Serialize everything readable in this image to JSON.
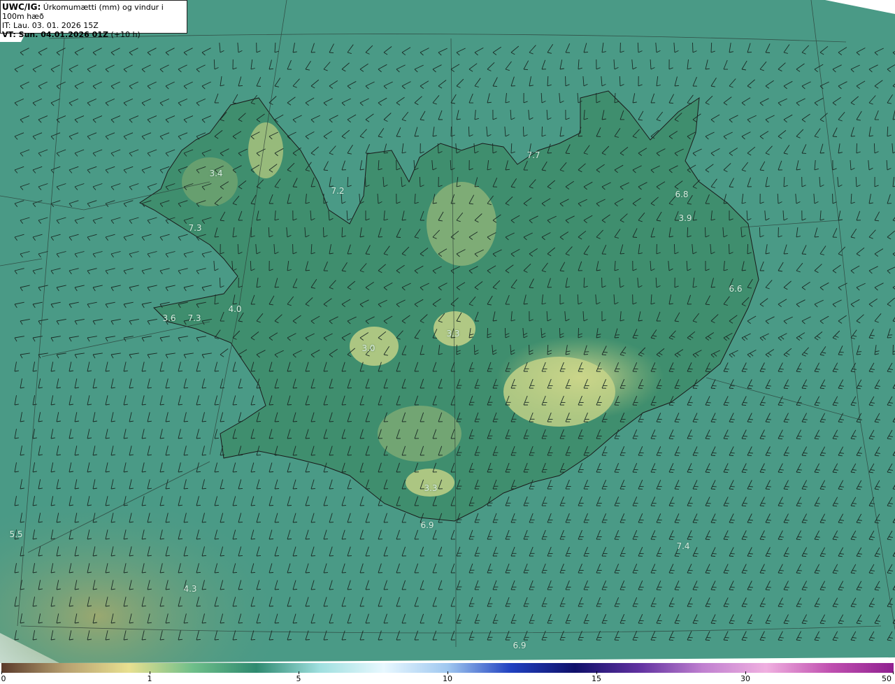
{
  "header": {
    "model": "UWC/IG:",
    "product": "Úrkomumætti (mm) og vindur i 100m hæð",
    "initial_time": "IT: Lau. 03. 01. 2026 15Z",
    "valid_time": "VT: Sun. 04.01.2026 01Z",
    "lead_time": "(+10 h)"
  },
  "value_labels": [
    "3.4",
    "7.2",
    "7.3",
    "4.0",
    "3.6",
    "7.3",
    "3.0",
    "3.3",
    "7.7",
    "6.8",
    "3.9",
    "6.6",
    "3.3",
    "6.9",
    "5.5",
    "4.3",
    "7.4",
    "6.9"
  ],
  "colorbar": {
    "unit": "mm",
    "ticks": [
      "0",
      "1",
      "5",
      "10",
      "15",
      "30",
      "50"
    ],
    "colors": [
      "#5a3a2a",
      "#b7a070",
      "#e8e090",
      "#6fbf8a",
      "#2e8a70",
      "#a0e0e0",
      "#e8f8ff",
      "#a0c8f0",
      "#2040c0",
      "#10106a",
      "#6030a0",
      "#c080d0",
      "#f0b0e0",
      "#c050b0",
      "#902090"
    ]
  },
  "colors": {
    "sea": "#4a9a86",
    "land": "#3e8a6c",
    "highland": "#b8cc80"
  }
}
